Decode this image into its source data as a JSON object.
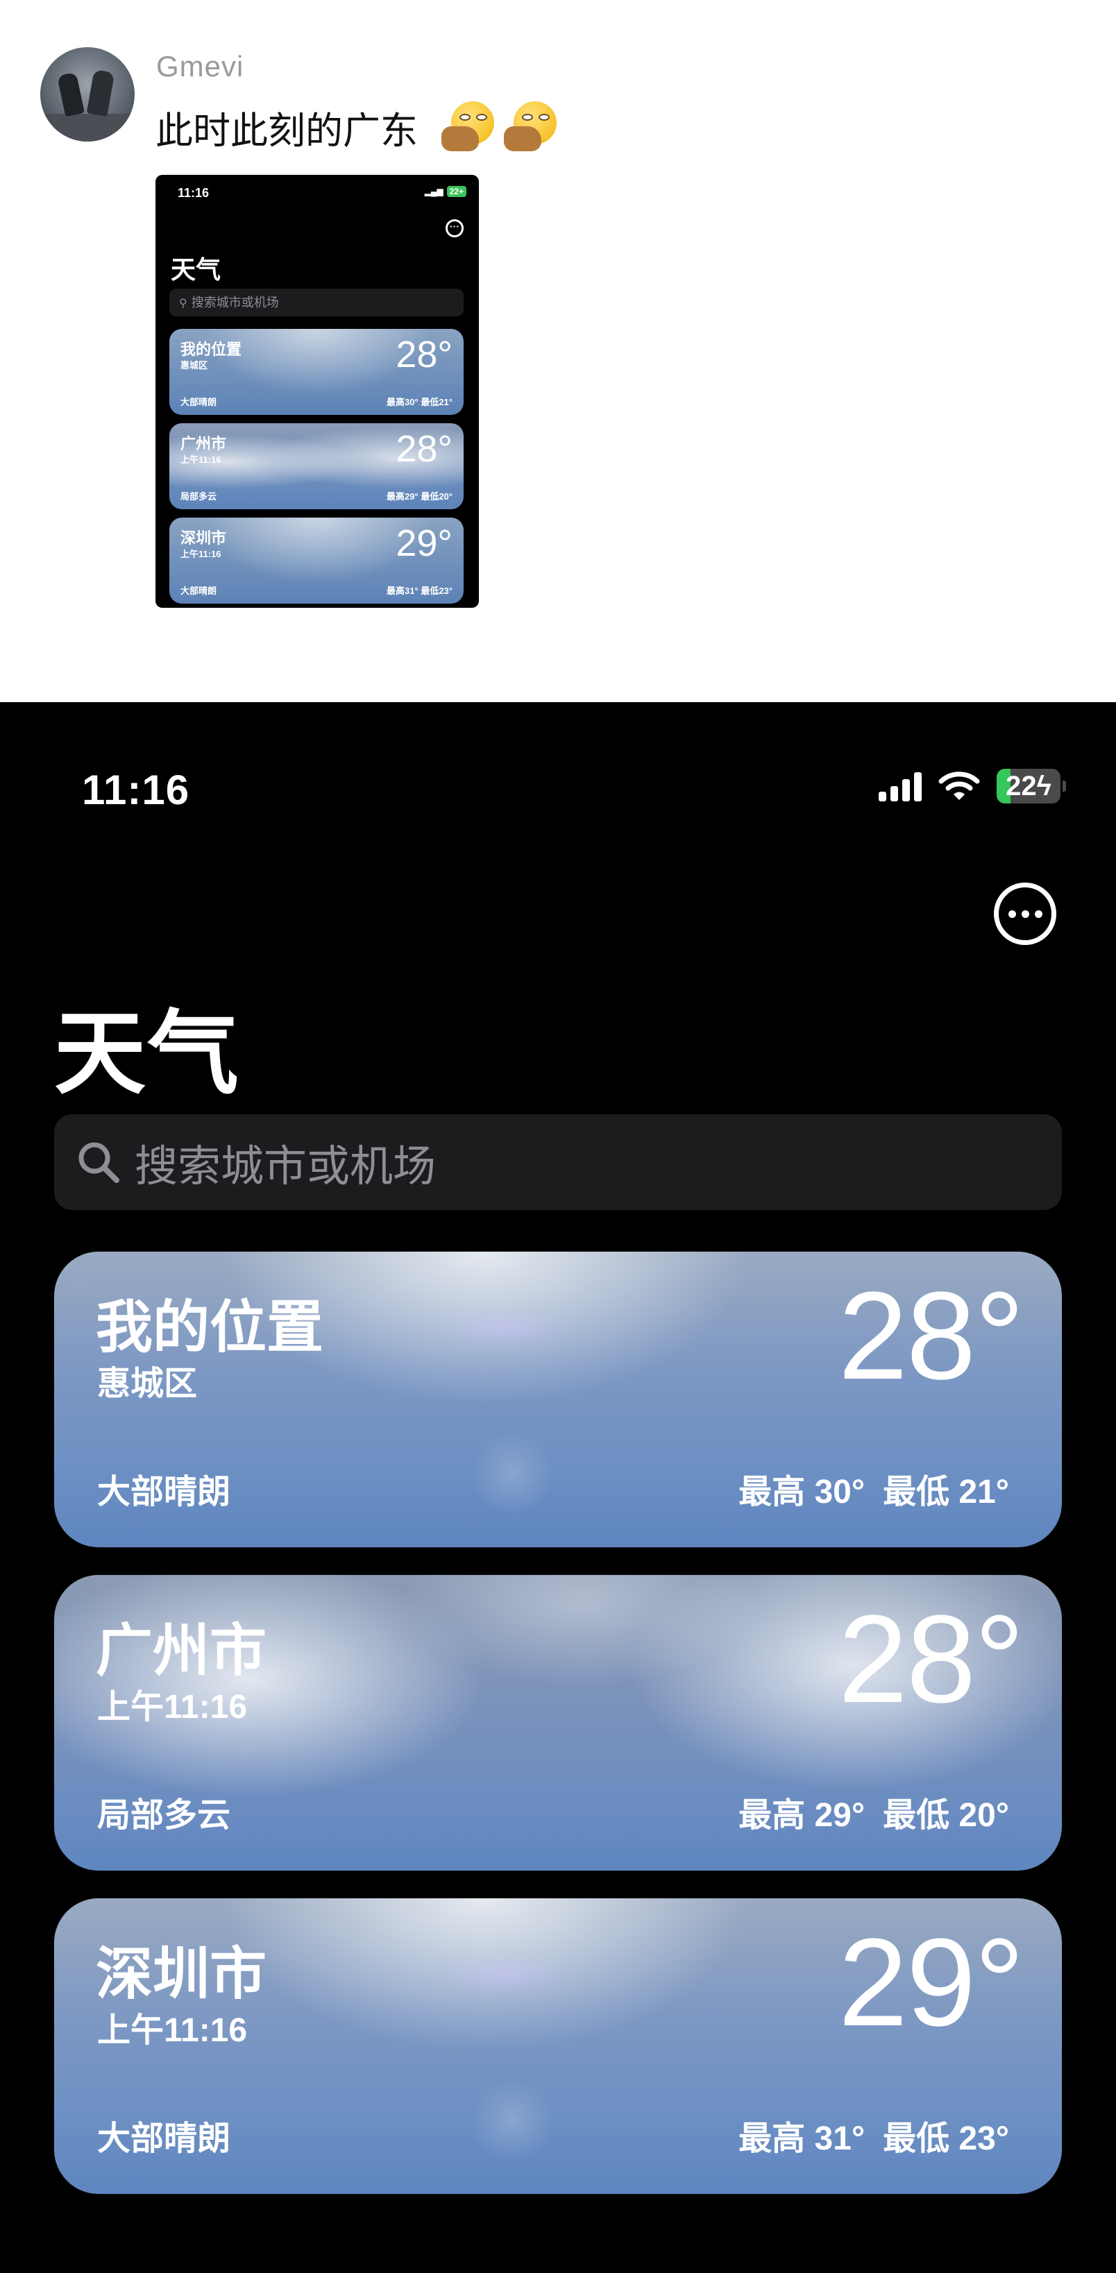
{
  "post": {
    "username": "Gmevi",
    "text": "此时此刻的广东",
    "emojis": [
      "face-with-rolling-eyes-emoji",
      "face-with-rolling-eyes-emoji"
    ]
  },
  "thumbnail": {
    "time": "11:16",
    "battery": "22+",
    "title": "天气",
    "search_placeholder": "搜索城市或机场",
    "cards": [
      {
        "name": "我的位置",
        "sub": "惠城区",
        "temp": "28°",
        "condition": "大部晴朗",
        "high": "最高30°",
        "low": "最低21°"
      },
      {
        "name": "广州市",
        "sub": "上午11:16",
        "temp": "28°",
        "condition": "局部多云",
        "high": "最高29°",
        "low": "最低20°"
      },
      {
        "name": "深圳市",
        "sub": "上午11:16",
        "temp": "29°",
        "condition": "大部晴朗",
        "high": "最高31°",
        "low": "最低23°"
      }
    ]
  },
  "app": {
    "status": {
      "time": "11:16",
      "battery_level": "22",
      "battery_fraction": 0.22,
      "charging": true
    },
    "title": "天气",
    "search": {
      "placeholder": "搜索城市或机场"
    },
    "locations": [
      {
        "name": "我的位置",
        "sub": "惠城区",
        "temp": "28°",
        "condition": "大部晴朗",
        "high": "最高 30°",
        "low": "最低 21°",
        "sky": "sunny"
      },
      {
        "name": "广州市",
        "sub": "上午11:16",
        "temp": "28°",
        "condition": "局部多云",
        "high": "最高 29°",
        "low": "最低 20°",
        "sky": "cloudy"
      },
      {
        "name": "深圳市",
        "sub": "上午11:16",
        "temp": "29°",
        "condition": "大部晴朗",
        "high": "最高 31°",
        "low": "最低 23°",
        "sky": "sunny"
      }
    ]
  },
  "colors": {
    "accent_green": "#34c759",
    "card_blue": "#6c8fc3",
    "search_bg": "#1c1c1e"
  }
}
